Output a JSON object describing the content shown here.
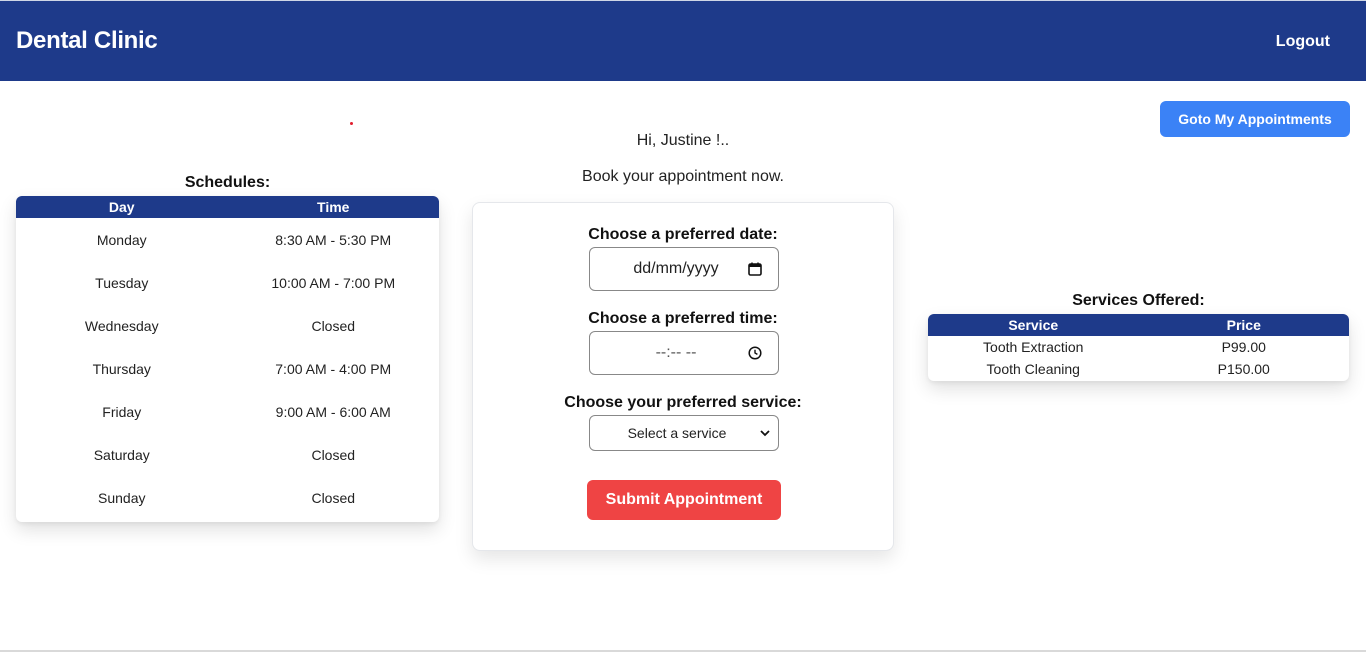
{
  "header": {
    "brand": "Dental Clinic",
    "logout": "Logout"
  },
  "goto_button": "Goto My Appointments",
  "greeting": {
    "line1": "Hi, Justine !..",
    "line2": "Book your appointment now."
  },
  "schedules": {
    "title": "Schedules:",
    "columns": [
      "Day",
      "Time"
    ],
    "rows": [
      {
        "day": "Monday",
        "time": "8:30 AM - 5:30 PM"
      },
      {
        "day": "Tuesday",
        "time": "10:00 AM - 7:00 PM"
      },
      {
        "day": "Wednesday",
        "time": "Closed"
      },
      {
        "day": "Thursday",
        "time": "7:00 AM - 4:00 PM"
      },
      {
        "day": "Friday",
        "time": "9:00 AM - 6:00 AM"
      },
      {
        "day": "Saturday",
        "time": "Closed"
      },
      {
        "day": "Sunday",
        "time": "Closed"
      }
    ]
  },
  "form": {
    "date_label": "Choose a preferred date:",
    "date_placeholder": "dd/mm/yyyy",
    "time_label": "Choose a preferred time:",
    "time_placeholder": "--:-- --",
    "service_label": "Choose your preferred service:",
    "service_selected": "Select a service",
    "submit": "Submit Appointment"
  },
  "services": {
    "title": "Services Offered:",
    "columns": [
      "Service",
      "Price"
    ],
    "rows": [
      {
        "service": "Tooth Extraction",
        "price": "P99.00"
      },
      {
        "service": "Tooth Cleaning",
        "price": "P150.00"
      }
    ]
  },
  "colors": {
    "navbar": "#1e3a8a",
    "primary_button": "#3b82f6",
    "submit_button": "#ef4444"
  }
}
